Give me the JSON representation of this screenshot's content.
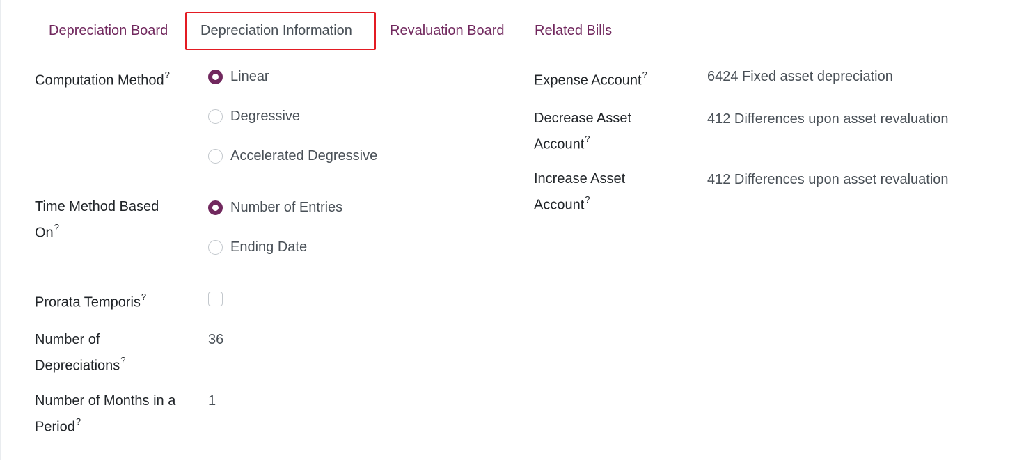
{
  "tabs": [
    {
      "label": "Depreciation Board"
    },
    {
      "label": "Depreciation Information"
    },
    {
      "label": "Revaluation Board"
    },
    {
      "label": "Related Bills"
    }
  ],
  "form": {
    "computation_method": {
      "label": "Computation Method",
      "help": "?",
      "options": [
        "Linear",
        "Degressive",
        "Accelerated Degressive"
      ],
      "selected": "Linear"
    },
    "time_method": {
      "label_line1": "Time Method Based",
      "label_line2": "On",
      "help": "?",
      "options": [
        "Number of Entries",
        "Ending Date"
      ],
      "selected": "Number of Entries"
    },
    "prorata": {
      "label": "Prorata Temporis",
      "help": "?",
      "checked": false
    },
    "num_depreciations": {
      "label_line1": "Number of",
      "label_line2": "Depreciations",
      "help": "?",
      "value": "36"
    },
    "num_months": {
      "label_line1": "Number of Months in a",
      "label_line2": "Period",
      "help": "?",
      "value": "1"
    },
    "expense_account": {
      "label": "Expense Account",
      "help": "?",
      "value": "6424 Fixed asset depreciation"
    },
    "decrease_account": {
      "label_line1": "Decrease Asset",
      "label_line2": "Account",
      "help": "?",
      "value": "412 Differences upon asset revaluation"
    },
    "increase_account": {
      "label_line1": "Increase Asset",
      "label_line2": "Account",
      "help": "?",
      "value": "412 Differences upon asset revaluation"
    }
  },
  "colors": {
    "accent": "#71285e",
    "highlight": "#e31b23"
  }
}
